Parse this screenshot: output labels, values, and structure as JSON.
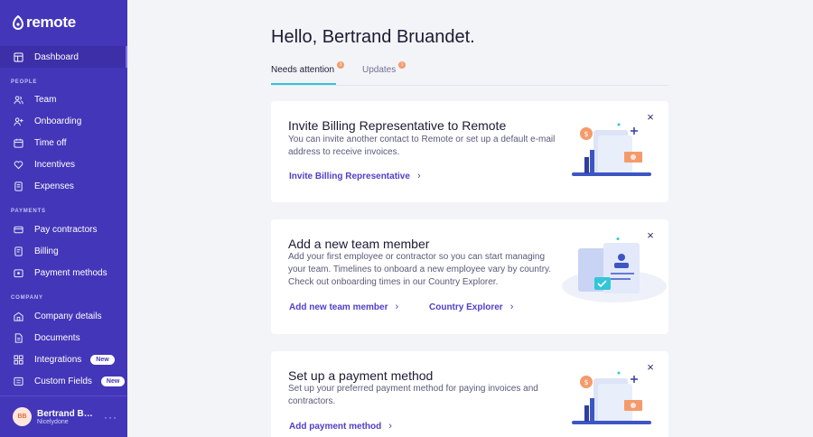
{
  "sidebar": {
    "logo_text": "remote",
    "items": [
      {
        "label": "Dashboard"
      },
      {
        "label": "Team"
      },
      {
        "label": "Onboarding"
      },
      {
        "label": "Time off"
      },
      {
        "label": "Incentives"
      },
      {
        "label": "Expenses"
      },
      {
        "label": "Pay contractors"
      },
      {
        "label": "Billing"
      },
      {
        "label": "Payment methods"
      },
      {
        "label": "Company details"
      },
      {
        "label": "Documents"
      },
      {
        "label": "Integrations",
        "badge": "New"
      },
      {
        "label": "Custom Fields",
        "badge": "New"
      }
    ],
    "sections": {
      "people": "PEOPLE",
      "payments": "PAYMENTS",
      "company": "COMPANY"
    },
    "user": {
      "initials": "BB",
      "name": "Bertrand Bruandet",
      "org": "Nicelydone",
      "more": "···"
    }
  },
  "main": {
    "greeting": "Hello, Bertrand Bruandet.",
    "tabs": [
      {
        "label": "Needs attention",
        "count": "3"
      },
      {
        "label": "Updates",
        "count": "1"
      }
    ],
    "cards": [
      {
        "title": "Invite Billing Representative to Remote",
        "desc_lines": [
          "You can invite another contact to Remote or set up a default e-mail",
          "address to receive invoices."
        ],
        "links": [
          "Invite Billing Representative"
        ]
      },
      {
        "title": "Add a new team member",
        "desc_lines": [
          "Add your first employee or contractor so you can start managing",
          "your team. Timelines to onboard a new employee vary by country.",
          "Check out onboarding times in our Country Explorer."
        ],
        "links": [
          "Add new team member",
          "Country Explorer"
        ]
      },
      {
        "title": "Set up a payment method",
        "desc_lines": [
          "Set up your preferred payment method for paying invoices and",
          "contractors."
        ],
        "links": [
          "Add payment method"
        ]
      }
    ]
  },
  "colors": {
    "sidebar": "#4436b9",
    "accent": "#33c6d6",
    "link": "#4f3fc9",
    "badge": "#f59b6b"
  }
}
